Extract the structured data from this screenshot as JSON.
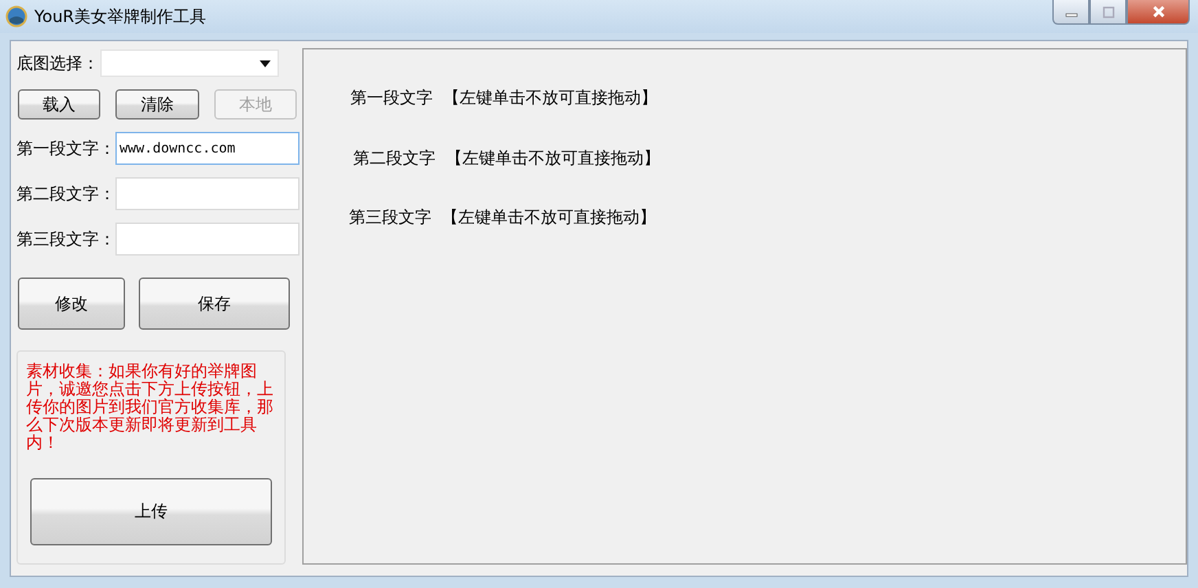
{
  "window": {
    "title": "YouR美女举牌制作工具"
  },
  "base_image": {
    "label": "底图选择："
  },
  "image_buttons": [
    {
      "label": "载入",
      "disabled": false
    },
    {
      "label": "清除",
      "disabled": false
    },
    {
      "label": "本地",
      "disabled": true
    }
  ],
  "text_fields": [
    {
      "label": "第一段文字：",
      "value": "www.downcc.com"
    },
    {
      "label": "第二段文字："
    },
    {
      "label": "第三段文字："
    }
  ],
  "action_buttons": [
    "修改",
    "保存"
  ],
  "notice": {
    "text": "素材收集：如果你有好的举牌图片，诚邀您点击下方上传按钮，上传你的图片到我们官方收集库，那么下次版本更新即将更新到工具内！",
    "upload_button": "上传"
  },
  "canvas": {
    "items": [
      {
        "label": "第一段文字",
        "hint": "【左键单击不放可直接拖动】"
      },
      {
        "label": "第二段文字",
        "hint": "【左键单击不放可直接拖动】"
      },
      {
        "label": "第三段文字",
        "hint": "【左键单击不放可直接拖动】"
      }
    ]
  }
}
